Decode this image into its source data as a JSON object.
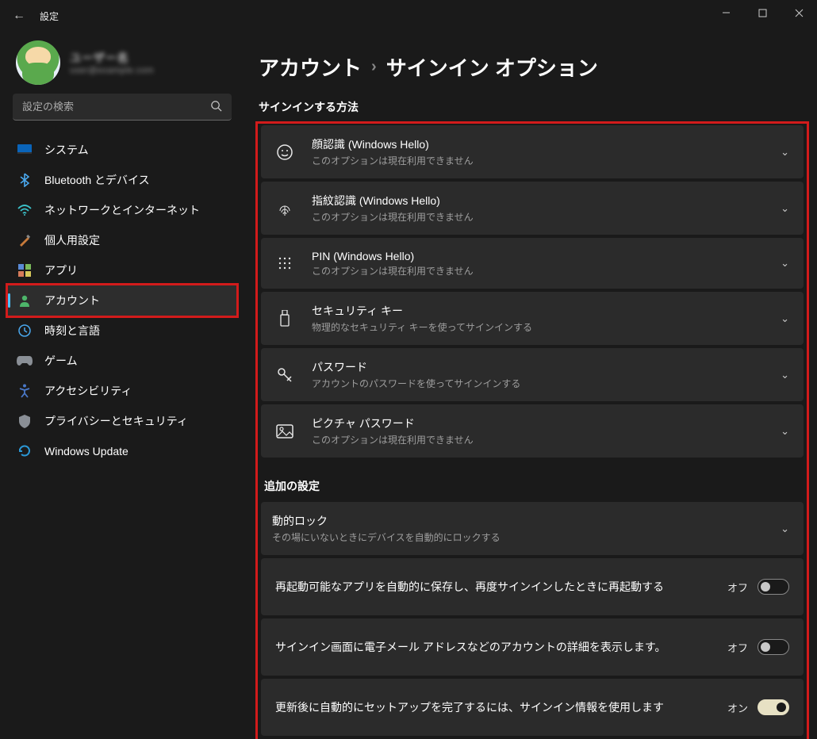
{
  "window": {
    "title": "設定"
  },
  "profile": {
    "name": "ユーザー名",
    "email": "user@example.com"
  },
  "search": {
    "placeholder": "設定の検索"
  },
  "sidebar": {
    "items": [
      {
        "label": "システム",
        "icon": "system"
      },
      {
        "label": "Bluetooth とデバイス",
        "icon": "bluetooth"
      },
      {
        "label": "ネットワークとインターネット",
        "icon": "network"
      },
      {
        "label": "個人用設定",
        "icon": "personalize"
      },
      {
        "label": "アプリ",
        "icon": "apps"
      },
      {
        "label": "アカウント",
        "icon": "account",
        "active": true
      },
      {
        "label": "時刻と言語",
        "icon": "time"
      },
      {
        "label": "ゲーム",
        "icon": "game"
      },
      {
        "label": "アクセシビリティ",
        "icon": "accessibility"
      },
      {
        "label": "プライバシーとセキュリティ",
        "icon": "privacy"
      },
      {
        "label": "Windows Update",
        "icon": "update"
      }
    ]
  },
  "breadcrumb": {
    "parent": "アカウント",
    "sep": "›",
    "current": "サインイン オプション"
  },
  "sections": {
    "signin_title": "サインインする方法",
    "addl_title": "追加の設定"
  },
  "signin": [
    {
      "title": "顔認識 (Windows Hello)",
      "sub": "このオプションは現在利用できません",
      "icon": "face"
    },
    {
      "title": "指紋認識 (Windows Hello)",
      "sub": "このオプションは現在利用できません",
      "icon": "finger"
    },
    {
      "title": "PIN (Windows Hello)",
      "sub": "このオプションは現在利用できません",
      "icon": "pin"
    },
    {
      "title": "セキュリティ キー",
      "sub": "物理的なセキュリティ キーを使ってサインインする",
      "icon": "usb"
    },
    {
      "title": "パスワード",
      "sub": "アカウントのパスワードを使ってサインインする",
      "icon": "key"
    },
    {
      "title": "ピクチャ パスワード",
      "sub": "このオプションは現在利用できません",
      "icon": "picture"
    }
  ],
  "additional": {
    "dynlock": {
      "title": "動的ロック",
      "sub": "その場にいないときにデバイスを自動的にロックする"
    },
    "toggles": [
      {
        "label": "再起動可能なアプリを自動的に保存し、再度サインインしたときに再起動する",
        "state": "オフ",
        "on": false
      },
      {
        "label": "サインイン画面に電子メール アドレスなどのアカウントの詳細を表示します。",
        "state": "オフ",
        "on": false
      },
      {
        "label": "更新後に自動的にセットアップを完了するには、サインイン情報を使用します",
        "state": "オン",
        "on": true
      }
    ]
  }
}
